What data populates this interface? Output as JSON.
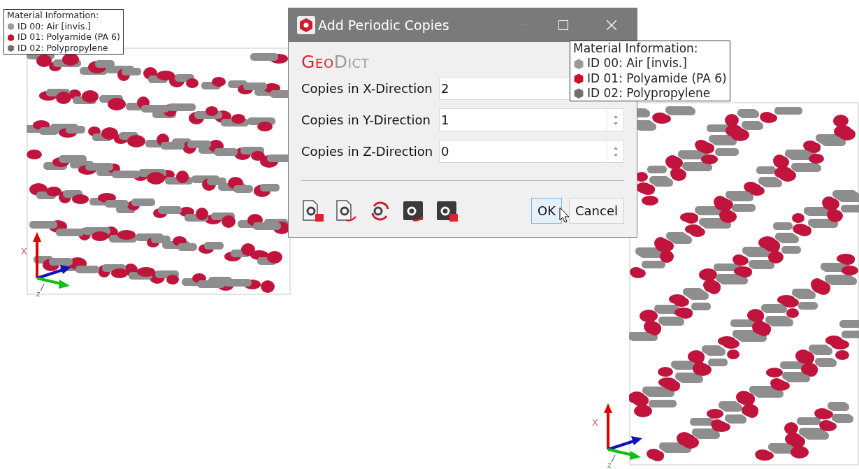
{
  "legends": [
    {
      "title": "Material Information:",
      "materials": [
        {
          "label": "ID 00: Air [invis.]",
          "color": "#9a9a9a"
        },
        {
          "label": "ID 01: Polyamide (PA 6)",
          "color": "#c8102e"
        },
        {
          "label": "ID 02: Polypropylene",
          "color": "#707070"
        }
      ]
    },
    {
      "title": "Material Information:",
      "materials": [
        {
          "label": "ID 00: Air [invis.]",
          "color": "#9a9a9a"
        },
        {
          "label": "ID 01: Polyamide (PA 6)",
          "color": "#c8102e"
        },
        {
          "label": "ID 02: Polypropylene",
          "color": "#707070"
        }
      ]
    }
  ],
  "axes": [
    {
      "labels": [
        "X",
        "Z"
      ]
    },
    {
      "labels": [
        "X",
        "Z"
      ]
    }
  ],
  "dialog": {
    "title": "Add Periodic Copies",
    "brand": [
      "Geo",
      "Dict"
    ],
    "fields": [
      {
        "label": "Copies in X-Direction",
        "value": "2"
      },
      {
        "label": "Copies in Y-Direction",
        "value": "1"
      },
      {
        "label": "Copies in Z-Direction",
        "value": "0"
      }
    ],
    "buttons": [
      {
        "label": "OK",
        "focused": true
      },
      {
        "label": "Cancel",
        "focused": false
      }
    ]
  }
}
